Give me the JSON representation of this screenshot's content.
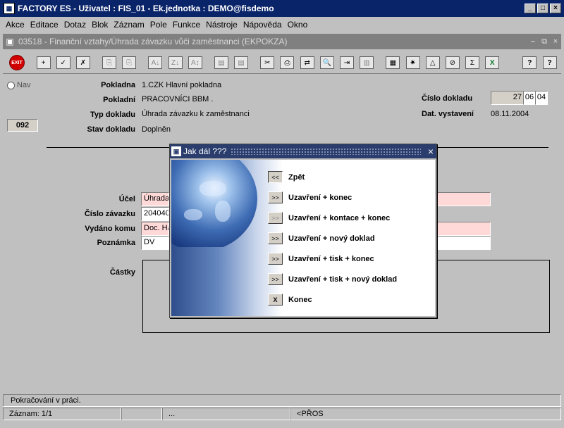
{
  "window": {
    "title": "FACTORY ES - Uživatel : FIS_01 - Ek.jednotka : DEMO@fisdemo",
    "minimize": "_",
    "maximize": "□",
    "close": "×"
  },
  "menu": [
    "Akce",
    "Editace",
    "Dotaz",
    "Blok",
    "Záznam",
    "Pole",
    "Funkce",
    "Nástroje",
    "Nápověda",
    "Okno"
  ],
  "form_window": {
    "title": "03518 - Finanční vztahy/Úhrada závazku vůči zaměstnanci (EKPOKZA)",
    "minimize": "⎯",
    "restore": "⧉",
    "close": "×"
  },
  "toolbar": {
    "exit": "EXIT",
    "glyphs": [
      "+",
      "✓",
      "✗",
      "⎘",
      "⎘",
      "A↓",
      "Z↓",
      "A↕",
      "▤",
      "▤",
      "✂",
      "⎙",
      "⇄",
      "🔍",
      "⇥",
      "▥",
      "▦",
      "✷",
      "△",
      "⊘",
      "Σ",
      "X",
      "?",
      "?"
    ]
  },
  "nav": {
    "label": "Nav",
    "record_number": "092"
  },
  "header": {
    "pokladna_label": "Pokladna",
    "pokladna_value": "1.CZK Hlavní pokladna",
    "pokladni_label": "Pokladní",
    "pokladni_value": "PRACOVNÍCI BBM .",
    "typ_label": "Typ dokladu",
    "typ_value": "Úhrada závazku k zaměstnanci",
    "stav_label": "Stav dokladu",
    "stav_value": "Doplněn",
    "cislo_label": "Číslo dokladu",
    "cislo_parts": [
      "27",
      "06",
      "04"
    ],
    "datum_label": "Dat. vystavení",
    "datum_value": "08.11.2004"
  },
  "detail": {
    "ucel_label": "Účel",
    "ucel_value": "Úhrada",
    "cislo_zavazku_label": "Číslo závazku",
    "cislo_zavazku_value": "204040",
    "vydano_label": "Vydáno komu",
    "vydano_value": "Doc. Ha",
    "poznamka_label": "Poznámka",
    "poznamka_value": "DV",
    "castky_label": "Částky"
  },
  "dialog": {
    "title": "Jak dál ???",
    "close": "×",
    "options": [
      {
        "button": "<<",
        "label": "Zpět"
      },
      {
        "button": ">>",
        "label": "Uzavření + konec"
      },
      {
        "button": ">>",
        "label": "Uzavření + kontace + konec"
      },
      {
        "button": ">>",
        "label": "Uzavření + nový doklad"
      },
      {
        "button": ">>",
        "label": "Uzavření + tisk + konec"
      },
      {
        "button": ">>",
        "label": "Uzavření + tisk + nový doklad"
      },
      {
        "button": "X",
        "label": "Konec"
      }
    ]
  },
  "status": {
    "message": "Pokračování v práci.",
    "record": "Záznam: 1/1",
    "ellipsis": "...",
    "mode": "<PŘOS"
  }
}
